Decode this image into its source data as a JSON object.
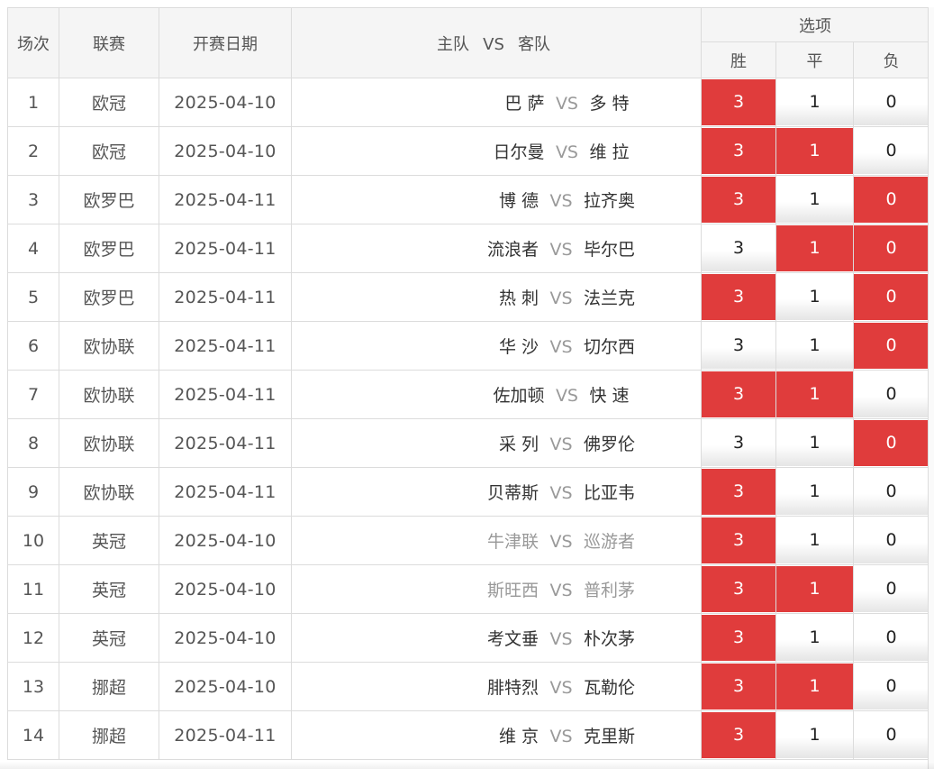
{
  "header": {
    "num": "场次",
    "league": "联赛",
    "date": "开赛日期",
    "home": "主队",
    "vs": "VS",
    "away": "客队",
    "options": "选项",
    "win": "胜",
    "draw": "平",
    "lose": "负"
  },
  "colors": {
    "selected": "#e03c3c",
    "header_bg": "#f5f5f5",
    "border": "#dcdcdc"
  },
  "rows": [
    {
      "num": "1",
      "league": "欧冠",
      "date": "2025-04-10",
      "home": "巴 萨",
      "vs": "VS",
      "away": "多 特",
      "muted": false,
      "win": "3",
      "draw": "1",
      "lose": "0",
      "sel": [
        true,
        false,
        false
      ]
    },
    {
      "num": "2",
      "league": "欧冠",
      "date": "2025-04-10",
      "home": "日尔曼",
      "vs": "VS",
      "away": "维 拉",
      "muted": false,
      "win": "3",
      "draw": "1",
      "lose": "0",
      "sel": [
        true,
        true,
        false
      ]
    },
    {
      "num": "3",
      "league": "欧罗巴",
      "date": "2025-04-11",
      "home": "博 德",
      "vs": "VS",
      "away": "拉齐奥",
      "muted": false,
      "win": "3",
      "draw": "1",
      "lose": "0",
      "sel": [
        true,
        false,
        true
      ]
    },
    {
      "num": "4",
      "league": "欧罗巴",
      "date": "2025-04-11",
      "home": "流浪者",
      "vs": "VS",
      "away": "毕尔巴",
      "muted": false,
      "win": "3",
      "draw": "1",
      "lose": "0",
      "sel": [
        false,
        true,
        true
      ]
    },
    {
      "num": "5",
      "league": "欧罗巴",
      "date": "2025-04-11",
      "home": "热 刺",
      "vs": "VS",
      "away": "法兰克",
      "muted": false,
      "win": "3",
      "draw": "1",
      "lose": "0",
      "sel": [
        true,
        false,
        true
      ]
    },
    {
      "num": "6",
      "league": "欧协联",
      "date": "2025-04-11",
      "home": "华 沙",
      "vs": "VS",
      "away": "切尔西",
      "muted": false,
      "win": "3",
      "draw": "1",
      "lose": "0",
      "sel": [
        false,
        false,
        true
      ]
    },
    {
      "num": "7",
      "league": "欧协联",
      "date": "2025-04-11",
      "home": "佐加顿",
      "vs": "VS",
      "away": "快 速",
      "muted": false,
      "win": "3",
      "draw": "1",
      "lose": "0",
      "sel": [
        true,
        true,
        false
      ]
    },
    {
      "num": "8",
      "league": "欧协联",
      "date": "2025-04-11",
      "home": "采 列",
      "vs": "VS",
      "away": "佛罗伦",
      "muted": false,
      "win": "3",
      "draw": "1",
      "lose": "0",
      "sel": [
        false,
        false,
        true
      ]
    },
    {
      "num": "9",
      "league": "欧协联",
      "date": "2025-04-11",
      "home": "贝蒂斯",
      "vs": "VS",
      "away": "比亚韦",
      "muted": false,
      "win": "3",
      "draw": "1",
      "lose": "0",
      "sel": [
        true,
        false,
        false
      ]
    },
    {
      "num": "10",
      "league": "英冠",
      "date": "2025-04-10",
      "home": "牛津联",
      "vs": "VS",
      "away": "巡游者",
      "muted": true,
      "win": "3",
      "draw": "1",
      "lose": "0",
      "sel": [
        true,
        false,
        false
      ]
    },
    {
      "num": "11",
      "league": "英冠",
      "date": "2025-04-10",
      "home": "斯旺西",
      "vs": "VS",
      "away": "普利茅",
      "muted": true,
      "win": "3",
      "draw": "1",
      "lose": "0",
      "sel": [
        true,
        true,
        false
      ]
    },
    {
      "num": "12",
      "league": "英冠",
      "date": "2025-04-10",
      "home": "考文垂",
      "vs": "VS",
      "away": "朴次茅",
      "muted": false,
      "win": "3",
      "draw": "1",
      "lose": "0",
      "sel": [
        true,
        false,
        false
      ]
    },
    {
      "num": "13",
      "league": "挪超",
      "date": "2025-04-10",
      "home": "腓特烈",
      "vs": "VS",
      "away": "瓦勒伦",
      "muted": false,
      "win": "3",
      "draw": "1",
      "lose": "0",
      "sel": [
        true,
        true,
        false
      ]
    },
    {
      "num": "14",
      "league": "挪超",
      "date": "2025-04-11",
      "home": "维 京",
      "vs": "VS",
      "away": "克里斯",
      "muted": false,
      "win": "3",
      "draw": "1",
      "lose": "0",
      "sel": [
        true,
        false,
        false
      ]
    }
  ]
}
